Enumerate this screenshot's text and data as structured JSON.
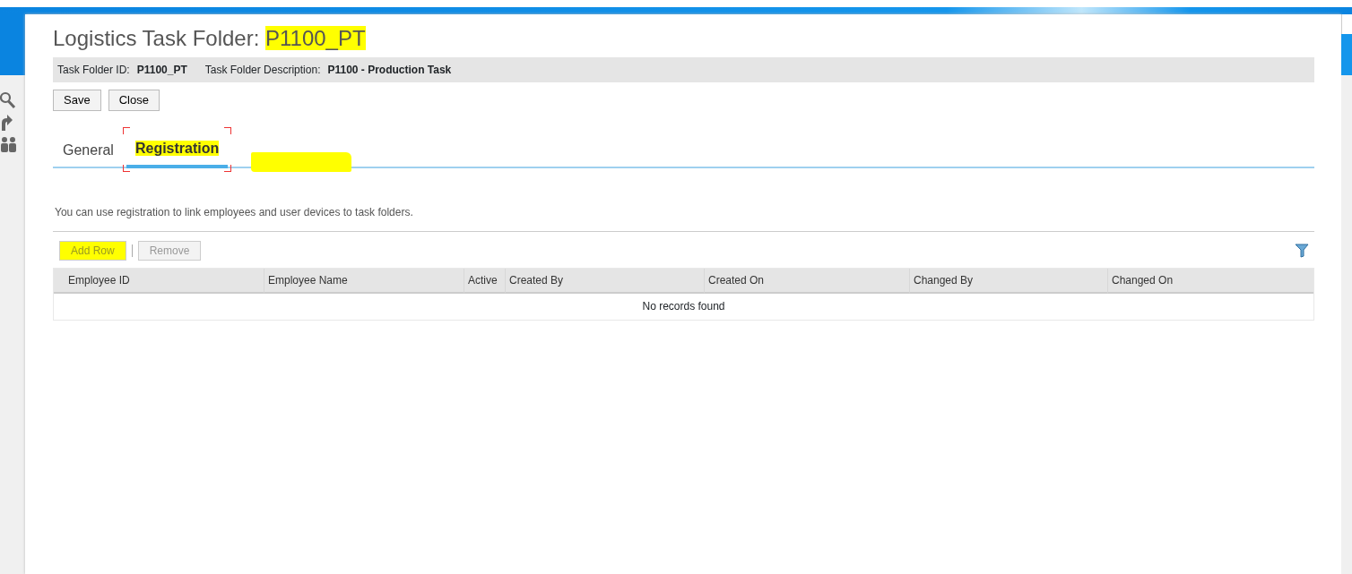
{
  "title": {
    "label": "Logistics Task Folder:",
    "value": "P1100_PT",
    "highlighted": true
  },
  "header_fields": [
    {
      "label": "Task Folder ID:",
      "value": "P1100_PT"
    },
    {
      "label": "Task Folder Description:",
      "value": "P1100 - Production Task"
    }
  ],
  "buttons": [
    "Save",
    "Close"
  ],
  "tabs": [
    {
      "label": "General",
      "selected": false,
      "highlighted": false
    },
    {
      "label": "Registration",
      "selected": true,
      "highlighted": true
    }
  ],
  "description": "You can use registration to link employees and user devices to task folders.",
  "toolbar": [
    {
      "label": "Add Row",
      "disabled": true,
      "highlighted": true
    },
    {
      "label": "Remove",
      "disabled": true,
      "highlighted": false
    }
  ],
  "table": {
    "columns": [
      "Employee ID",
      "Employee Name",
      "Active",
      "Created By",
      "Created On",
      "Changed By",
      "Changed On"
    ],
    "empty_text": "No records found"
  }
}
